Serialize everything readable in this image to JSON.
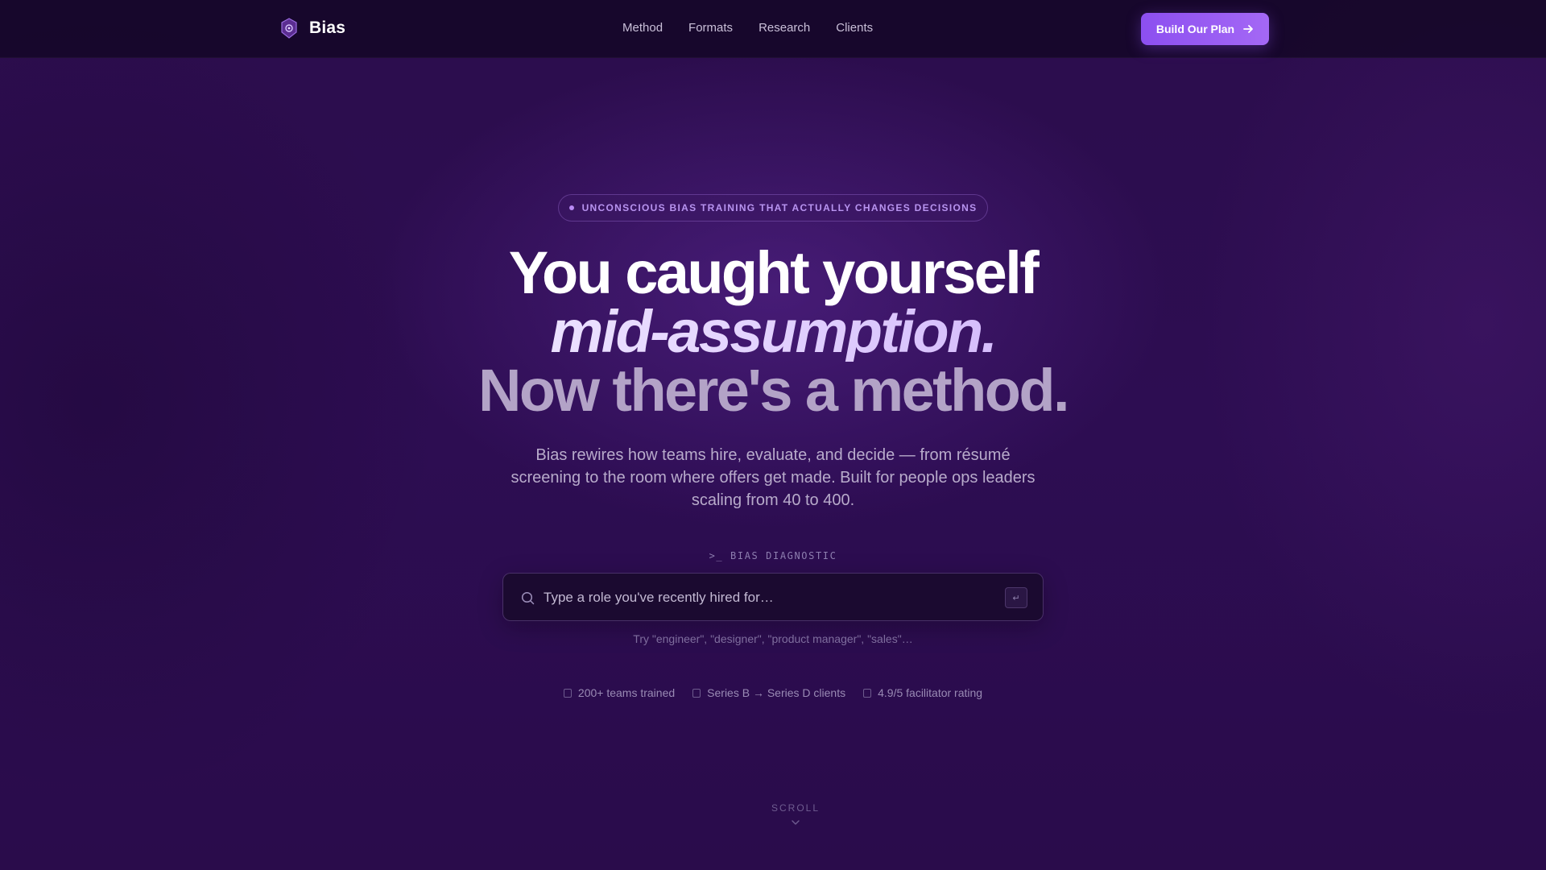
{
  "nav": {
    "brand": "Bias",
    "links": [
      "Method",
      "Formats",
      "Research",
      "Clients"
    ],
    "cta_label": "Build Our Plan"
  },
  "hero": {
    "badge": "UNCONSCIOUS BIAS TRAINING THAT ACTUALLY CHANGES DECISIONS",
    "headline_line1": "You caught yourself",
    "headline_line2": "mid-assumption.",
    "headline_line3": "Now there's a method.",
    "subtitle": "Bias rewires how teams hire, evaluate, and decide — from résumé screening to the room where offers get made. Built for people ops leaders scaling from 40 to 400."
  },
  "diagnostic": {
    "label": ">_ BIAS DIAGNOSTIC",
    "placeholder": "Type a role you've recently hired for…",
    "enter_key": "↵",
    "hint": "Try \"engineer\", \"designer\", \"product manager\", \"sales\"…"
  },
  "stats": [
    "200+ teams trained",
    "Series B → Series D clients",
    "4.9/5 facilitator rating"
  ],
  "scroll_label": "SCROLL",
  "colors": {
    "background": "#2c0d4d",
    "accent": "#8c4ff0",
    "accent_light": "#b98af5"
  },
  "icons": [
    "brand-logo-icon",
    "arrow-right-icon",
    "search-icon",
    "enter-key-icon",
    "chevron-down-icon"
  ]
}
